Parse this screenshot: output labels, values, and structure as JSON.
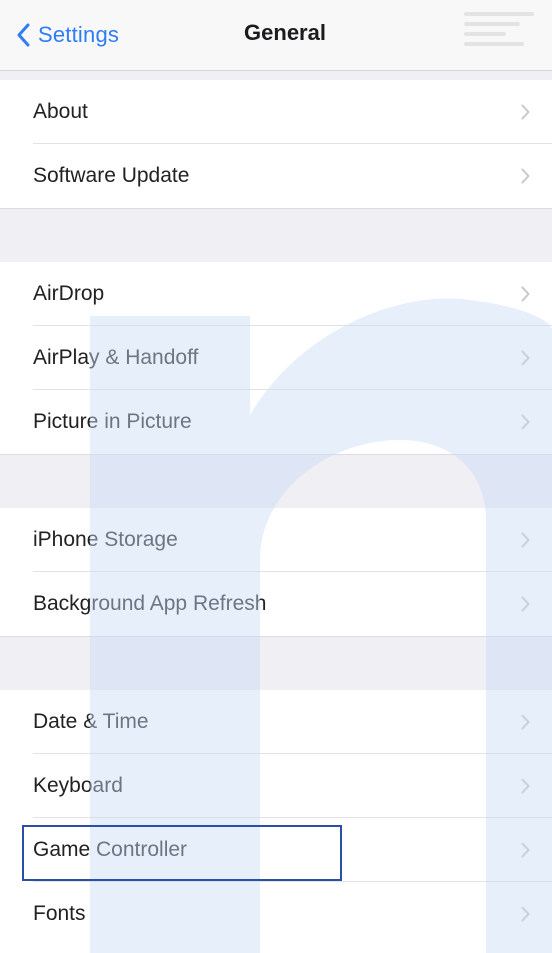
{
  "navbar": {
    "back_label": "Settings",
    "title": "General"
  },
  "groups": [
    {
      "items": [
        {
          "label": "About"
        },
        {
          "label": "Software Update"
        }
      ]
    },
    {
      "items": [
        {
          "label": "AirDrop"
        },
        {
          "label": "AirPlay & Handoff"
        },
        {
          "label": "Picture in Picture"
        }
      ]
    },
    {
      "items": [
        {
          "label": "iPhone Storage"
        },
        {
          "label": "Background App Refresh"
        }
      ]
    },
    {
      "items": [
        {
          "label": "Date & Time"
        },
        {
          "label": "Keyboard"
        },
        {
          "label": "Game Controller"
        },
        {
          "label": "Fonts"
        }
      ]
    }
  ],
  "highlighted_item": "Game Controller",
  "icons": {
    "back": "chevron-left-icon",
    "disclosure": "chevron-right-icon"
  },
  "colors": {
    "accent": "#2f7cf6",
    "highlight_border": "#2b4fa8",
    "watermark": "#c9dcf6"
  }
}
